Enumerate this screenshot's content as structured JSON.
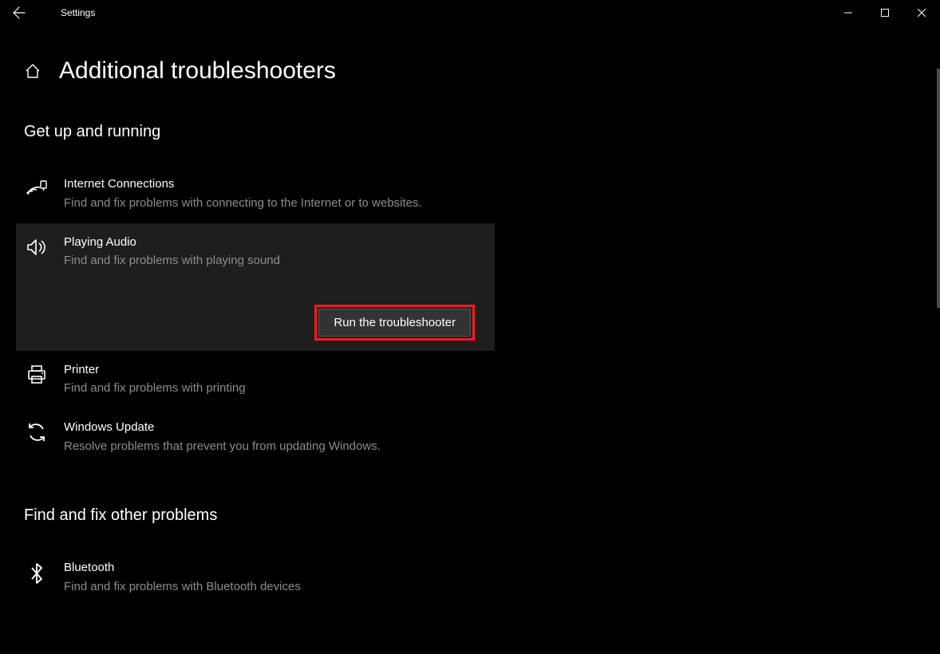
{
  "window": {
    "title": "Settings"
  },
  "page": {
    "title": "Additional troubleshooters"
  },
  "section1": {
    "title": "Get up and running",
    "items": [
      {
        "title": "Internet Connections",
        "desc": "Find and fix problems with connecting to the Internet or to websites."
      },
      {
        "title": "Playing Audio",
        "desc": "Find and fix problems with playing sound"
      },
      {
        "title": "Printer",
        "desc": "Find and fix problems with printing"
      },
      {
        "title": "Windows Update",
        "desc": "Resolve problems that prevent you from updating Windows."
      }
    ]
  },
  "run_button_label": "Run the troubleshooter",
  "section2": {
    "title": "Find and fix other problems",
    "items": [
      {
        "title": "Bluetooth",
        "desc": "Find and fix problems with Bluetooth devices"
      }
    ]
  }
}
